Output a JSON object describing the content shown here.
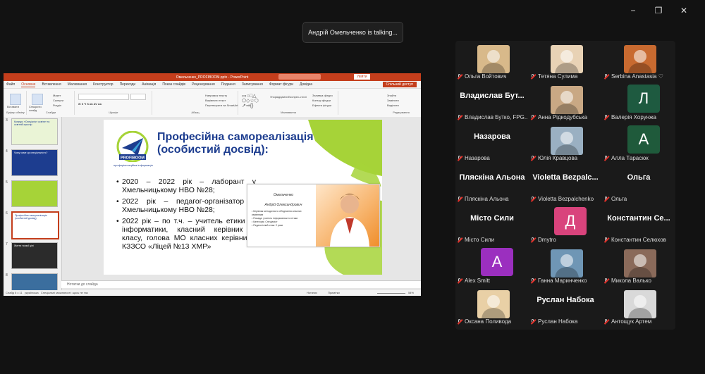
{
  "meeting": {
    "talking_indicator": "Андрій Омельченко is talking...",
    "window_controls": [
      "−",
      "❐",
      "✕"
    ]
  },
  "powerpoint": {
    "file_title": "Омельченко_PROFIBOOM.pptx - PowerPoint",
    "search_placeholder": "Скажіть, що потрібно зробити",
    "signin": "Увійти",
    "tabs": [
      "Файл",
      "Основне",
      "Вставлення",
      "Малювання",
      "Конструктор",
      "Переходи",
      "Анімація",
      "Показ слайдів",
      "Рецензування",
      "Подання",
      "Записування",
      "Формат фігури",
      "Довідка"
    ],
    "active_tab": "Основне",
    "share_label": "Спільний доступ",
    "ribbon": {
      "paste": "Вставити",
      "new_slide": "Створити слайд",
      "layout": "Макет",
      "reset": "Скинути",
      "section": "Розділ",
      "clipboard": "Буфер обміну",
      "slides": "Слайди",
      "font": "Шрифт",
      "paragraph": "Абзац",
      "text_direction": "Напрямок тексту",
      "align_text": "Вирівняти текст",
      "smartart": "Перетворити на SmartArt",
      "arrange": "Упорядкувати",
      "quick_styles": "Експрес-стилі",
      "drawing": "Малювання",
      "shape_fill": "Заливка фігури",
      "shape_outline": "Контур фігури",
      "shape_effects": "Ефекти фігури",
      "find": "Знайти",
      "replace": "Замінити",
      "select": "Виділити",
      "editing": "Редагування"
    },
    "thumbnails": [
      {
        "num": "3",
        "text": "Конкурс «Спеціаліст освіти» та освітній простір"
      },
      {
        "num": "4",
        "text": "Чому саме ця спеціальність?"
      },
      {
        "num": "5",
        "text": ""
      },
      {
        "num": "6",
        "text": "Професійна самореалізація (особистий досвід)"
      },
      {
        "num": "7",
        "text": "Життя та мої цілі"
      },
      {
        "num": "8",
        "text": ""
      }
    ],
    "selected_thumb": "6",
    "notes_placeholder": "Нотатки до слайда",
    "status": {
      "slide_counter": "Слайд 6 з 11",
      "language": "українська",
      "accessibility": "Спеціальні можливості: щось не так",
      "notes": "Нотатки",
      "comments": "Примітки",
      "zoom": "54%"
    },
    "slide": {
      "title": "Професійна самореалізація (особистий досвід):",
      "logo_text": "PROFIBOOM",
      "logo_caption": "профорієнтаційна інформація",
      "bullets": [
        "2020 – 2022 рік – лаборант у Хмельницькому НВО №28;",
        "2022 рік – педагог-організатор у Хмельницькому НВО №28;",
        "2022 рік – по т.ч. – учитель етики та інформатики, класний керівник 6 класу, голова МО класних керівників КЗЗСО «Ліцей №13 ХМР»"
      ],
      "card": {
        "surname": "Омельченко",
        "full_name": "Андрій Олександрович",
        "lines": [
          "• Керівник методичного об'єднання класних керівників",
          "• Посада: учитель інформатики та етики",
          "• Категорія: Спеціаліст",
          "• Педагогічний стаж: 2 роки"
        ]
      }
    }
  },
  "participants": [
    {
      "id": "olha-voitovych",
      "label": "Ольга Войтович",
      "display": "photo",
      "color": "#d8b98a"
    },
    {
      "id": "tetiana-sulyma",
      "label": "Тетяна Сулима",
      "display": "photo",
      "color": "#e8d2b5"
    },
    {
      "id": "serbina",
      "label": "Serbina Anastasia ♡",
      "display": "photo",
      "color": "#c86a30"
    },
    {
      "id": "vladyslav-butko",
      "label": "Владислав Бутко, FPG...",
      "display": "name",
      "big_name": "Владислав Бут..."
    },
    {
      "id": "anna-ridkodubska",
      "label": "Анна Рідкодубська",
      "display": "photo",
      "color": "#c9a884"
    },
    {
      "id": "valeria-khorunzha",
      "label": "Валерія Хорунжа",
      "display": "initial",
      "initial": "Л",
      "color": "#1e5a40"
    },
    {
      "id": "nazarova",
      "label": "Назарова",
      "display": "name",
      "big_name": "Назарова"
    },
    {
      "id": "yulia-kravtsova",
      "label": "Юлія Кравцова",
      "display": "photo",
      "color": "#9ab0c2"
    },
    {
      "id": "alla-tarasiuk",
      "label": "Алла Тарасюк",
      "display": "initial",
      "initial": "А",
      "color": "#1f5a3b"
    },
    {
      "id": "pliaskina",
      "label": "Пляскіна Альона",
      "display": "name",
      "big_name": "Пляскіна Альона"
    },
    {
      "id": "violetta",
      "label": "Violetta Bezpalchenko",
      "display": "name",
      "big_name": "Violetta Bezpalc..."
    },
    {
      "id": "olha",
      "label": "Ольга",
      "display": "name",
      "big_name": "Ольга"
    },
    {
      "id": "misto-syly",
      "label": "Місто Сили",
      "display": "name",
      "big_name": "Місто Сили"
    },
    {
      "id": "dmytro",
      "label": "Dmytro",
      "display": "initial",
      "initial": "Д",
      "color": "#d9437c"
    },
    {
      "id": "kostiantyn",
      "label": "Константин Селюхов",
      "display": "name",
      "big_name": "Константин Се..."
    },
    {
      "id": "alex-smitt",
      "label": "Alex Smitt",
      "display": "initial",
      "initial": "А",
      "color": "#9b2fbf"
    },
    {
      "id": "hanna",
      "label": "Ганна Маринченко",
      "display": "photo",
      "color": "#6f96b5"
    },
    {
      "id": "mykola",
      "label": "Микола Валько",
      "display": "photo",
      "color": "#8a6a5a"
    },
    {
      "id": "oksana",
      "label": "Оксана Поливода",
      "display": "photo",
      "color": "#e9d0a6"
    },
    {
      "id": "ruslan",
      "label": "Руслан Набока",
      "display": "name",
      "big_name": "Руслан Набока"
    },
    {
      "id": "antoshchuk",
      "label": "Антощук Артем",
      "display": "photo",
      "color": "#d9d9d9"
    }
  ],
  "colors": {
    "accent": "#c43e1c",
    "slide_title": "#1d3d8f",
    "slide_green": "#a6d338"
  }
}
